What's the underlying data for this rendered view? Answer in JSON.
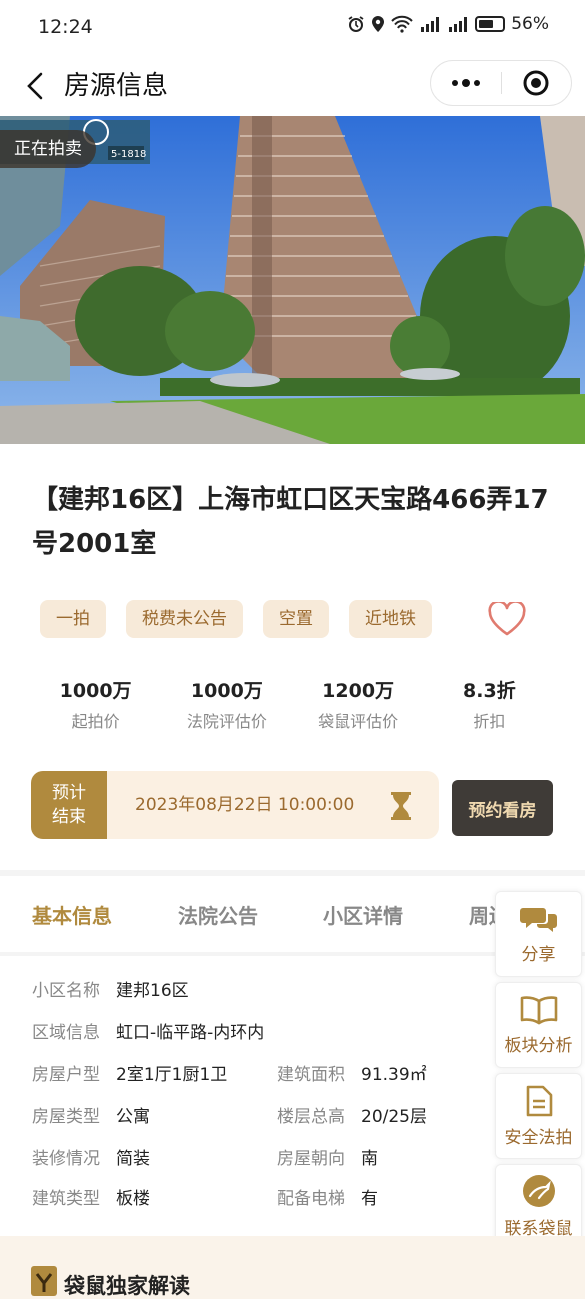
{
  "status_bar": {
    "time": "12:24",
    "network": "4G",
    "battery": "56%"
  },
  "navbar": {
    "title": "房源信息"
  },
  "hero": {
    "badge": "正在拍卖",
    "sign_text": "5-1818"
  },
  "listing": {
    "title": "【建邦16区】上海市虹口区天宝路466弄17号2001室"
  },
  "tags": [
    "一拍",
    "税费未公告",
    "空置",
    "近地铁"
  ],
  "prices": [
    {
      "value": "1000万",
      "label": "起拍价"
    },
    {
      "value": "1000万",
      "label": "法院评估价"
    },
    {
      "value": "1200万",
      "label": "袋鼠评估价"
    },
    {
      "value": "8.3折",
      "label": "折扣"
    }
  ],
  "countdown": {
    "label_line1": "预计",
    "label_line2": "结束",
    "end_time": "2023年08月22日 10:00:00"
  },
  "view_button": "预约看房",
  "tabs": [
    "基本信息",
    "法院公告",
    "小区详情",
    "周边"
  ],
  "basic_info": [
    {
      "key": "小区名称",
      "value": "建邦16区"
    },
    {
      "key": "区域信息",
      "value": "虹口-临平路-内环内"
    },
    {
      "key": "房屋户型",
      "value": "2室1厅1厨1卫"
    },
    {
      "key": "建筑面积",
      "value": "91.39㎡"
    },
    {
      "key": "房屋类型",
      "value": "公寓"
    },
    {
      "key": "楼层总高",
      "value": "20/25层"
    },
    {
      "key": "装修情况",
      "value": "简装"
    },
    {
      "key": "房屋朝向",
      "value": "南"
    },
    {
      "key": "建筑类型",
      "value": "板楼"
    },
    {
      "key": "配备电梯",
      "value": "有"
    }
  ],
  "side_actions": [
    {
      "label": "分享",
      "icon": "chat-icon"
    },
    {
      "label": "板块分析",
      "icon": "book-icon"
    },
    {
      "label": "安全法拍",
      "icon": "document-icon"
    },
    {
      "label": "联系袋鼠",
      "icon": "kangaroo-logo-icon"
    }
  ],
  "bottom_section": {
    "title": "袋鼠独家解读"
  },
  "colors": {
    "accent": "#b08a3e",
    "tag_bg": "#f7ead9",
    "heart": "#e07b6f"
  }
}
